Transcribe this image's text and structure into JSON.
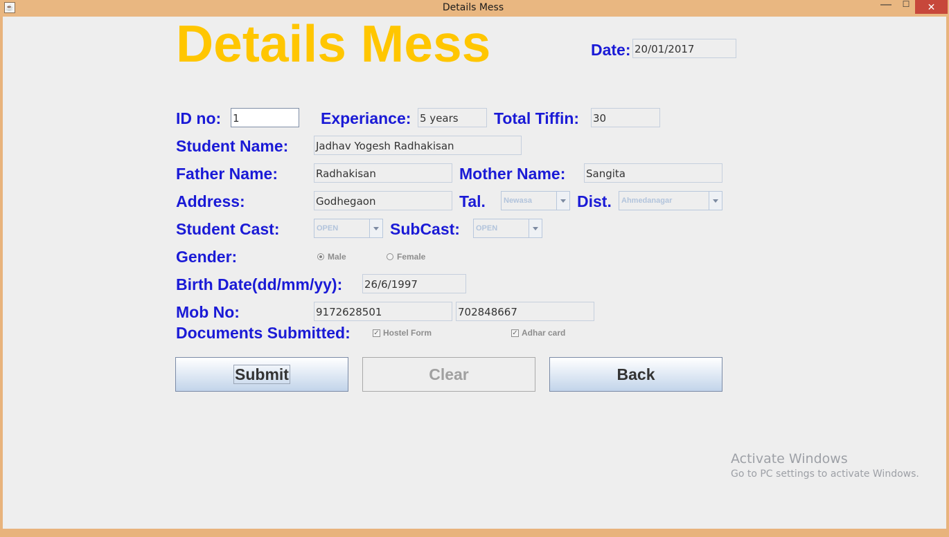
{
  "window": {
    "title": "Details Mess",
    "minimize": "—",
    "maximize": "☐",
    "close": "✕"
  },
  "form": {
    "heading": "Details Mess",
    "date": {
      "label": "Date:",
      "value": "20/01/2017"
    },
    "id_no": {
      "label": "ID no:",
      "value": "1"
    },
    "experience": {
      "label": "Experiance:",
      "value": "5 years"
    },
    "total_tiffin": {
      "label": "Total Tiffin:",
      "value": "30"
    },
    "student_name": {
      "label": "Student Name:",
      "value": "Jadhav Yogesh Radhakisan"
    },
    "father_name": {
      "label": "Father Name:",
      "value": "Radhakisan"
    },
    "mother_name": {
      "label": "Mother Name:",
      "value": "Sangita"
    },
    "address": {
      "label": "Address:",
      "value": "Godhegaon"
    },
    "tal": {
      "label": "Tal.",
      "value": "Newasa"
    },
    "dist": {
      "label": "Dist.",
      "value": "Ahmedanagar"
    },
    "student_cast": {
      "label": "Student Cast:",
      "value": "OPEN"
    },
    "subcast": {
      "label": "SubCast:",
      "value": "OPEN"
    },
    "gender": {
      "label": "Gender:",
      "options": [
        "Male",
        "Female"
      ],
      "selected": "Male"
    },
    "birth_date": {
      "label": "Birth Date(dd/mm/yy):",
      "value": "26/6/1997"
    },
    "mob_no": {
      "label": "Mob No:",
      "value1": "9172628501",
      "value2": "702848667"
    },
    "documents": {
      "label": "Documents Submitted:",
      "items": [
        {
          "label": "Hostel Form",
          "checked": true
        },
        {
          "label": "Adhar card",
          "checked": true
        }
      ]
    }
  },
  "buttons": {
    "submit": "Submit",
    "clear": "Clear",
    "back": "Back"
  },
  "watermark": {
    "line1": "Activate Windows",
    "line2": "Go to PC settings to activate Windows."
  },
  "colors": {
    "label": "#1a1ad6",
    "heading": "#ffc600",
    "titlebar": "#e9b781",
    "close": "#c7473b"
  }
}
